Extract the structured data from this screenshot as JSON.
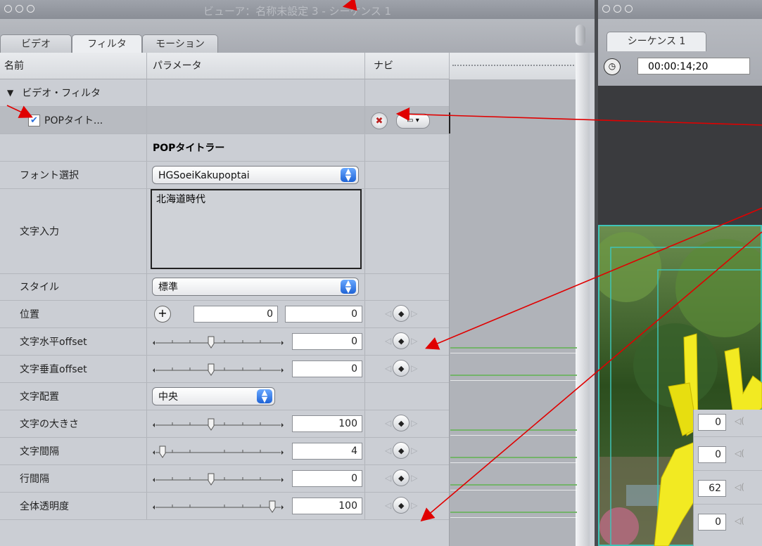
{
  "viewer": {
    "title": "ビューア：名称未設定 3 - シーケンス 1",
    "tabs": [
      {
        "label": "ビデオ"
      },
      {
        "label": "フィルタ"
      },
      {
        "label": "モーション"
      }
    ],
    "columns": {
      "name": "名前",
      "param": "パラメータ",
      "navi": "ナビ"
    },
    "section": "ビデオ・フィルタ",
    "filter_name": "POPタイト...",
    "filter_title": "POPタイトラー",
    "rows": {
      "font_select": {
        "label": "フォント選択",
        "value": "HGSoeiKakupoptai"
      },
      "text_input": {
        "label": "文字入力",
        "value": "北海道時代"
      },
      "style": {
        "label": "スタイル",
        "value": "標準"
      },
      "position": {
        "label": "位置",
        "x": "0",
        "y": "0"
      },
      "h_offset": {
        "label": "文字水平offset",
        "value": "0"
      },
      "v_offset": {
        "label": "文字垂直offset",
        "value": "0"
      },
      "align": {
        "label": "文字配置",
        "value": "中央"
      },
      "size": {
        "label": "文字の大きさ",
        "value": "100"
      },
      "spacing": {
        "label": "文字間隔",
        "value": "4"
      },
      "line_spacing": {
        "label": "行間隔",
        "value": "0"
      },
      "opacity": {
        "label": "全体透明度",
        "value": "100"
      }
    }
  },
  "canvas": {
    "tab": "シーケンス 1",
    "timecode": "00:00:14;20",
    "overlay_values": [
      "0",
      "0",
      "62",
      "0"
    ]
  },
  "colors": {
    "annotation": "#e00000",
    "accent": "#2a6fdb",
    "guides": "#3fc4b8"
  }
}
